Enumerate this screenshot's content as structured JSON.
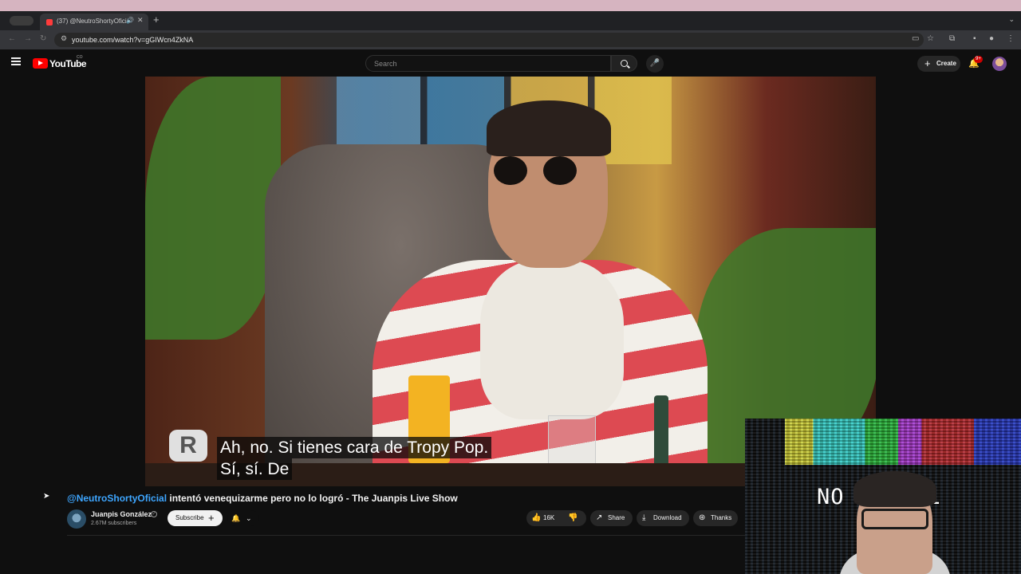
{
  "browser": {
    "tab_pill": "",
    "tab_title": "(37) @NeutroShortyOficial",
    "tab_audio_icon": "speaker-icon",
    "url": "youtube.com/watch?v=gGIWcn4ZkNA"
  },
  "header": {
    "logo_text": "YouTube",
    "logo_country": "CO",
    "search_placeholder": "Search",
    "create_label": "Create",
    "notifications_badge": "9+"
  },
  "player": {
    "caption_line1": "Ah, no. Si tienes cara de Tropy Pop.",
    "caption_line2": "Sí, sí. De",
    "watermark_letter": "R"
  },
  "video": {
    "title_mention": "@NeutroShortyOficial",
    "title_rest": " intentó venequizarme pero no lo logró - The Juanpis Live Show",
    "channel_name": "Juanpis González",
    "subscribers": "2.67M subscribers",
    "subscribe_label": "Subscribe",
    "likes": "16K",
    "share_label": "Share",
    "download_label": "Download",
    "thanks_label": "Thanks"
  },
  "webcam": {
    "overlay_text": "NO SIGNAL"
  }
}
